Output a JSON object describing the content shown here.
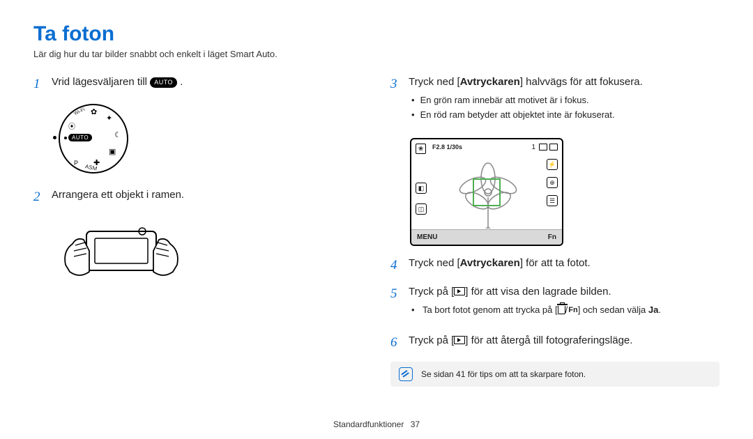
{
  "title": "Ta foton",
  "subtitle": "Lär dig hur du tar bilder snabbt och enkelt i läget Smart Auto.",
  "steps": {
    "s1_pre": "Vrid lägesväljaren till ",
    "auto_label": "AUTO",
    "s1_post": " .",
    "s2": "Arrangera ett objekt i ramen.",
    "s3_pre": "Tryck ned [",
    "s3_bold": "Avtryckaren",
    "s3_post": "] halvvägs för att fokusera.",
    "s3_b1": "En grön ram innebär att motivet är i fokus.",
    "s3_b2": "En röd ram betyder att objektet inte är fokuserat.",
    "s4_pre": "Tryck ned [",
    "s4_bold": "Avtryckaren",
    "s4_post": "] för att ta fotot.",
    "s5_pre": "Tryck på [",
    "s5_post": "] för att visa den lagrade bilden.",
    "s5_b1_pre": "Ta bort fotot genom att trycka på [",
    "s5_b1_mid": "/",
    "s5_b1_fn": "Fn",
    "s5_b1_post_a": "] och sedan välja ",
    "s5_b1_bold": "Ja",
    "s5_b1_post_b": ".",
    "s6_pre": "Tryck på [",
    "s6_post": "] för att återgå till fotograferingsläge."
  },
  "dial": {
    "wifi": "Wi-Fi",
    "asm": "ASM"
  },
  "screen": {
    "exposure": "F2.8  1/30s",
    "count": "1",
    "menu": "MENU",
    "fn": "Fn",
    "macro_glyph": "❀"
  },
  "tip": "Se sidan 41 för tips om att ta skarpare foton.",
  "footer": {
    "section": "Standardfunktioner",
    "page": "37"
  }
}
